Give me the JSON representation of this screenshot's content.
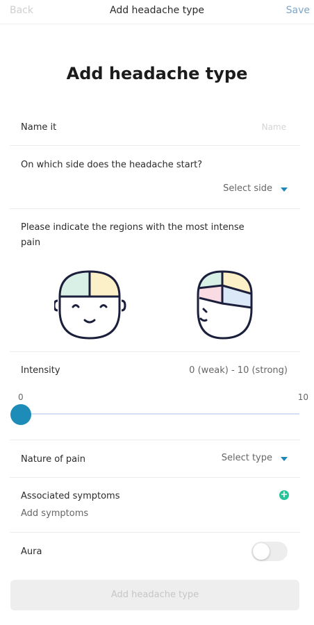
{
  "nav": {
    "back": "Back",
    "title": "Add headache type",
    "save": "Save"
  },
  "page_title": "Add headache type",
  "name_field": {
    "label": "Name it",
    "placeholder": "Name"
  },
  "side": {
    "question": "On which side does the headache start?",
    "select_label": "Select side"
  },
  "regions": {
    "prompt_line1": "Please indicate the regions with the most intense",
    "prompt_line2": "pain"
  },
  "intensity": {
    "label": "Intensity",
    "scale_hint": "0 (weak) - 10 (strong)",
    "min": "0",
    "max": "10",
    "value": 0
  },
  "nature": {
    "label": "Nature of pain",
    "select_label": "Select type"
  },
  "symptoms": {
    "label": "Associated symptoms",
    "add_label": "Add symptoms"
  },
  "aura": {
    "label": "Aura",
    "enabled": false
  },
  "submit_label": "Add headache type",
  "colors": {
    "accent": "#1e8cb8",
    "add_icon": "#29c39a",
    "region_green": "#d8f0e6",
    "region_yellow": "#fbf0c8",
    "region_pink": "#f9dbe3",
    "region_blue": "#dbe8f8",
    "outline": "#1b1f3b"
  }
}
